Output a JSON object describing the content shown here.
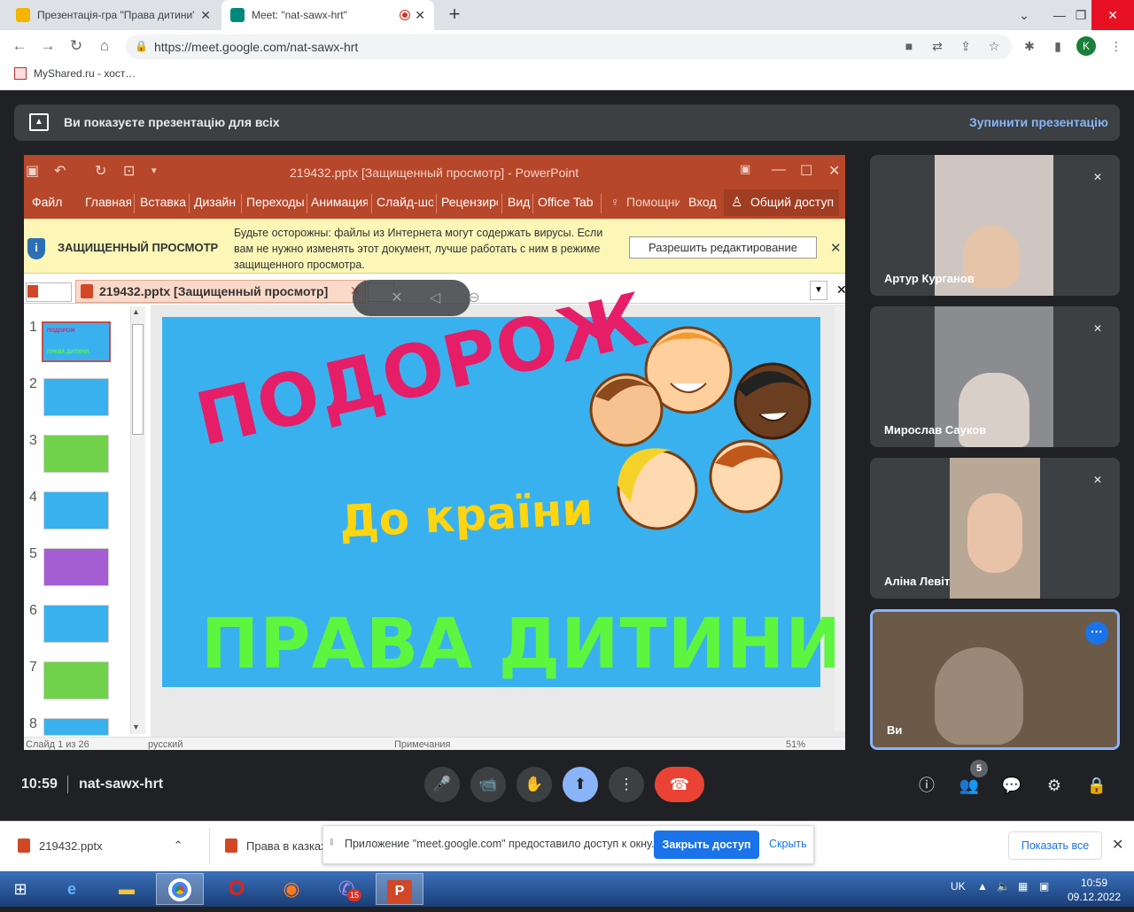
{
  "browser": {
    "tabs": [
      {
        "title": "Презентація-гра \"Права дитини\"",
        "close": "✕",
        "favicon_color": "#f4b400"
      },
      {
        "title": "Meet: \"nat-sawx-hrt\"",
        "close": "✕",
        "favicon_color": "#00897b"
      }
    ],
    "new_tab": "+",
    "window_controls": {
      "chevron": "⌄",
      "minimize": "—",
      "restore": "❐",
      "close": "✕"
    },
    "url": "https://meet.google.com/nat-sawx-hrt",
    "profile_initial": "K",
    "bookmark": "MyShared.ru - хост…"
  },
  "meet": {
    "banner_text": "Ви показуєте презентацію для всіх",
    "stop_presentation": "Зупинити презентацію",
    "time": "10:59",
    "meeting_code": "nat-sawx-hrt",
    "people_count": "5",
    "participants": [
      {
        "name": "Артур Курганов",
        "muted": true,
        "bg": "#cfc6c1"
      },
      {
        "name": "Мирослав Сауков",
        "muted": true,
        "bg": "#8a8c8f"
      },
      {
        "name": "Аліна Левіт",
        "muted": true,
        "bg": "#b9a896"
      },
      {
        "name": "Ви",
        "muted": false,
        "bg": "#6b5a48"
      }
    ],
    "controls": {
      "mic": "🎤",
      "camera": "📹",
      "hand": "✋",
      "present": "⬆",
      "more": "⋮",
      "leave": "☎"
    },
    "right_icons": {
      "info": "ⓘ",
      "people": "👥",
      "chat": "💬",
      "activities": "⚙",
      "host": "🔒"
    }
  },
  "ppt": {
    "window_title": "219432.pptx [Защищенный просмотр] - PowerPoint",
    "ribbon": [
      "Файл",
      "Главная",
      "Вставка",
      "Дизайн",
      "Переходы",
      "Анимация",
      "Слайд-шоу",
      "Рецензирование",
      "Вид",
      "Office Tab",
      "Помощник",
      "Вход",
      "Общий доступ"
    ],
    "protected_label": "ЗАЩИЩЕННЫЙ ПРОСМОТР",
    "protected_message": "Будьте осторожны: файлы из Интернета могут содержать вирусы. Если вам не нужно изменять этот документ, лучше работать с ним в режиме защищенного просмотра.",
    "enable_editing": "Разрешить редактирование",
    "close": "✕",
    "doc_tab": "219432.pptx [Защищенный просмотр]",
    "slide_numbers": [
      "1",
      "2",
      "3",
      "4",
      "5",
      "6",
      "7",
      "8"
    ],
    "thumb_colors": [
      "#3ab1ef",
      "#3ab1ef",
      "#6fd24a",
      "#3ab1ef",
      "#a45ed1",
      "#3ab1ef",
      "#6fd24a",
      "#3ab1ef"
    ],
    "slide_text": {
      "line1": "ПОДОРОЖ",
      "line2": "До країни",
      "line3": "ПРАВА ДИТИНИ"
    },
    "status": {
      "slide": "Слайд 1 из 26",
      "lang": "русский",
      "notes": "Примечания",
      "zoom": "51%"
    }
  },
  "downloads": {
    "items": [
      "219432.pptx",
      "Права в казках"
    ],
    "share_notice": "Приложение \"meet.google.com\" предоставило доступ к окну.",
    "stop_share": "Закрыть доступ",
    "hide": "Скрыть",
    "show_all": "Показать все"
  },
  "taskbar": {
    "lang": "UK",
    "time": "10:59",
    "date": "09.12.2022",
    "viber_badge": "15"
  }
}
